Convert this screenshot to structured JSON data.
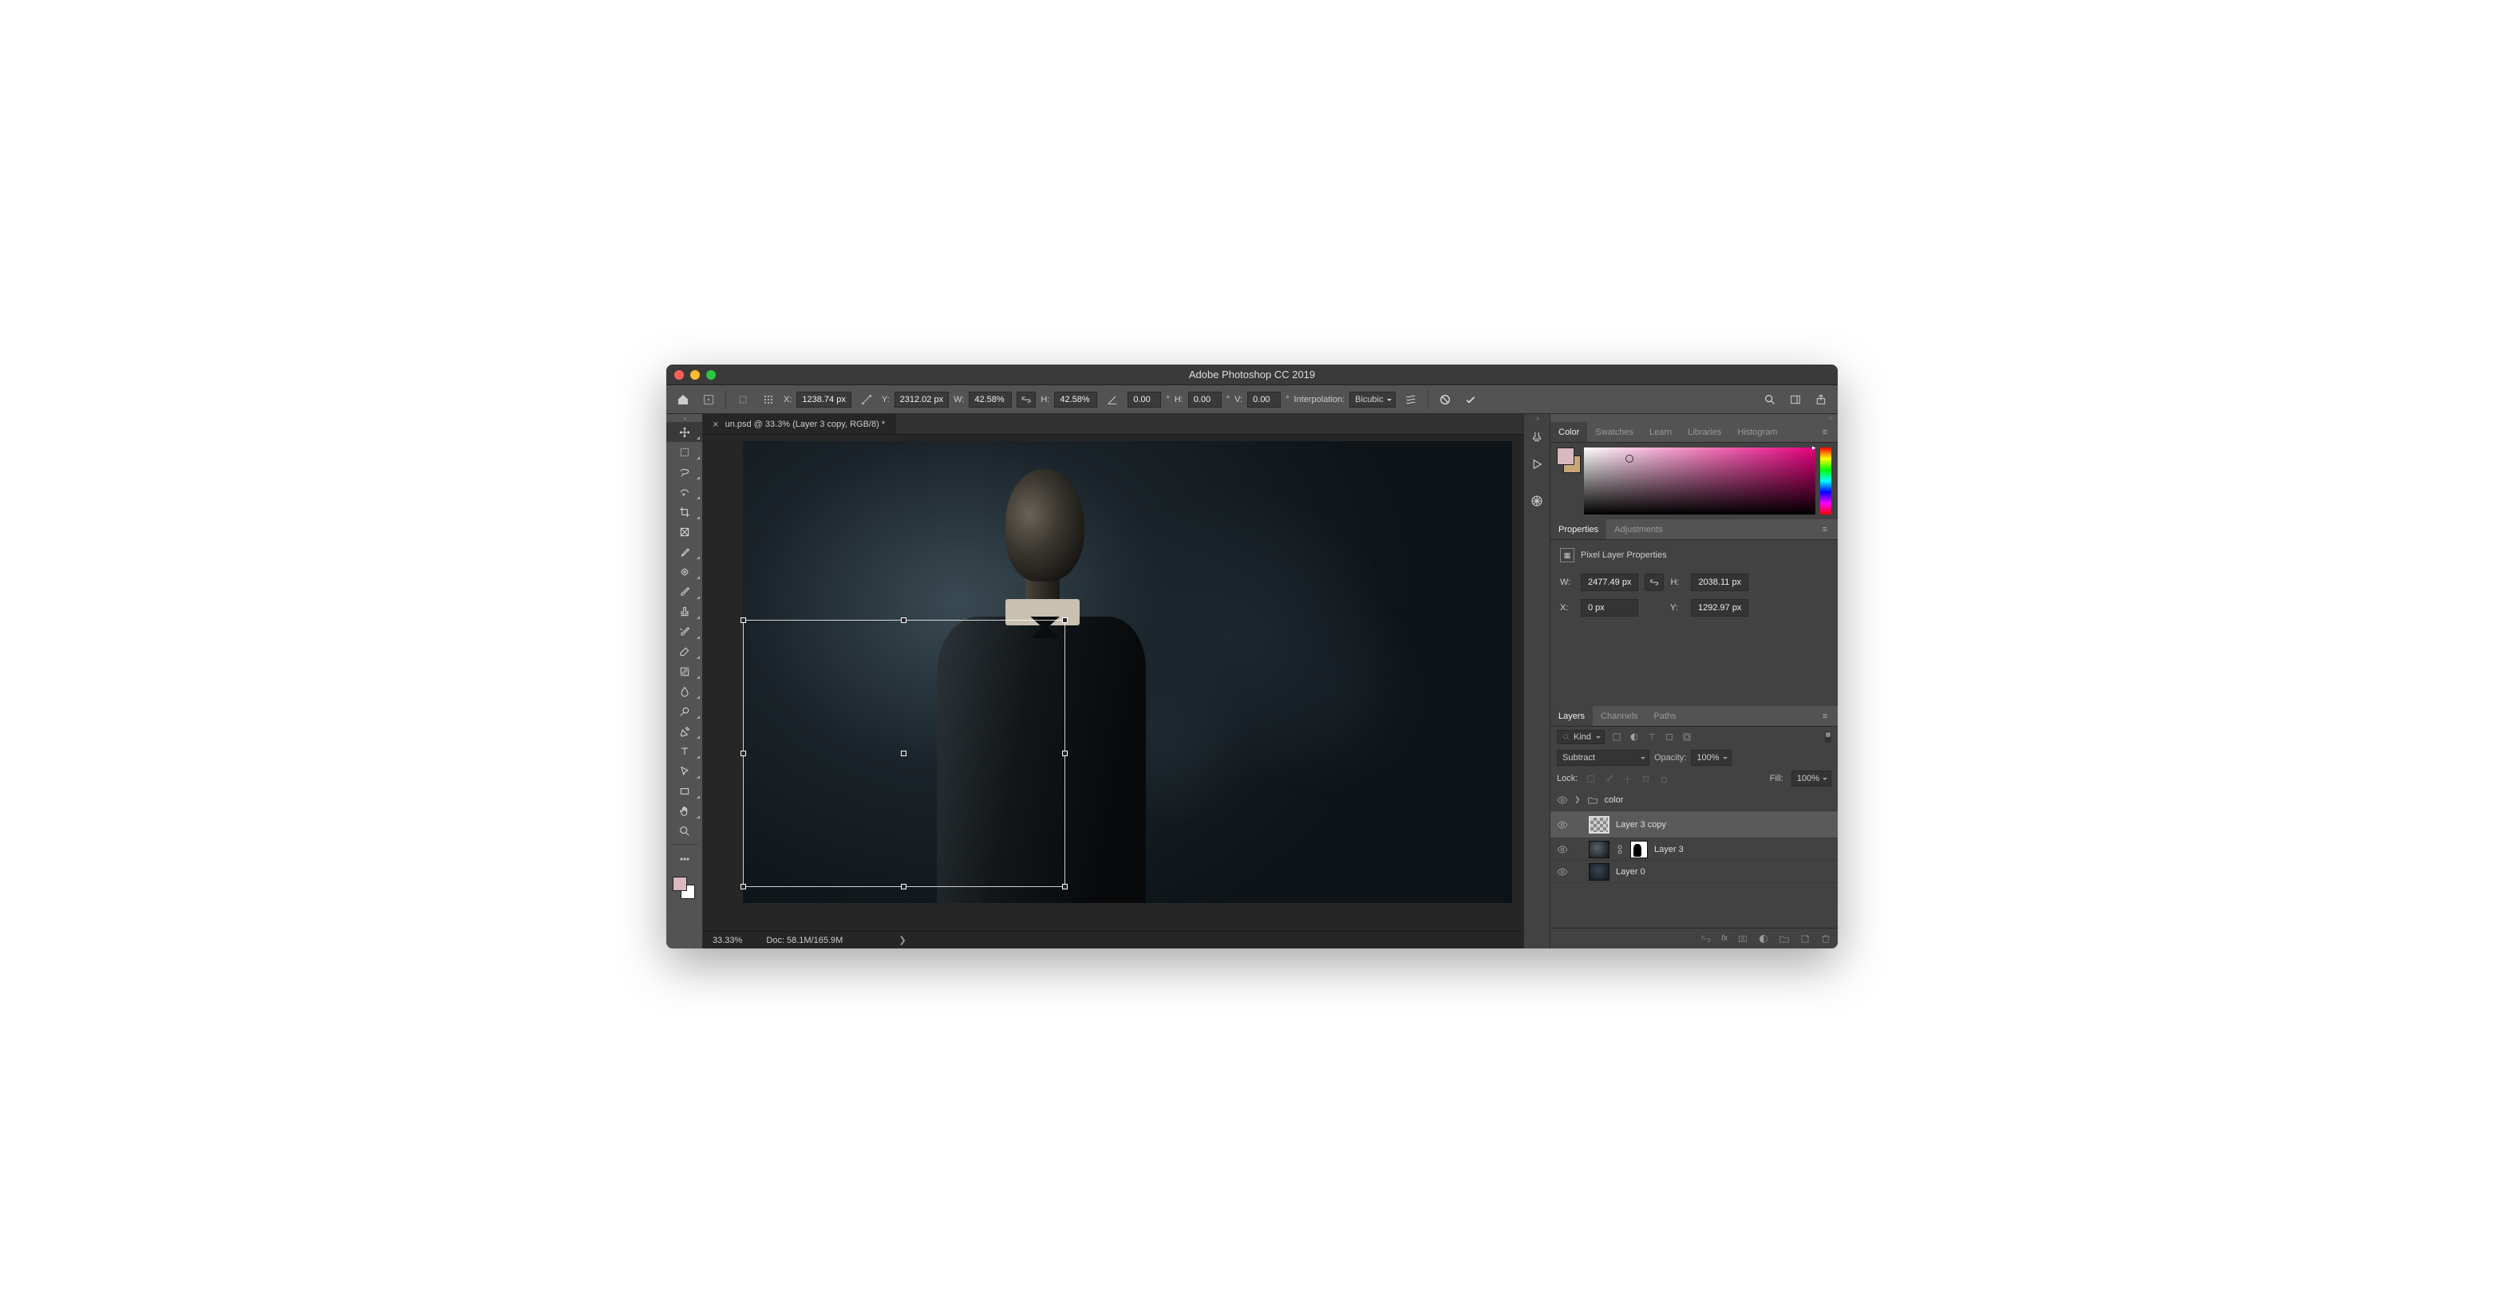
{
  "window": {
    "title": "Adobe Photoshop CC 2019"
  },
  "options": {
    "x_label": "X:",
    "x": "1238.74 px",
    "y_label": "Y:",
    "y": "2312.02 px",
    "w_label": "W:",
    "w": "42.58%",
    "h_label": "H:",
    "h": "42.58%",
    "angle": "0.00",
    "angle_unit": "°",
    "skew_h_label": "H:",
    "skew_h": "0.00",
    "skew_h_unit": "°",
    "skew_v_label": "V:",
    "skew_v": "0.00",
    "skew_v_unit": "°",
    "interp_label": "Interpolation:",
    "interp": "Bicubic"
  },
  "tab": {
    "title": "un.psd @ 33.3% (Layer 3 copy, RGB/8) *"
  },
  "status": {
    "zoom": "33.33%",
    "doc": "Doc: 58.1M/165.9M"
  },
  "panels": {
    "color_tabs": [
      "Color",
      "Swatches",
      "Learn",
      "Libraries",
      "Histogram"
    ],
    "props_tabs": [
      "Properties",
      "Adjustments"
    ],
    "layers_tabs": [
      "Layers",
      "Channels",
      "Paths"
    ]
  },
  "properties": {
    "title": "Pixel Layer Properties",
    "w_label": "W:",
    "w": "2477.49 px",
    "h_label": "H:",
    "h": "2038.11 px",
    "x_label": "X:",
    "x": "0 px",
    "y_label": "Y:",
    "y": "1292.97 px"
  },
  "layers": {
    "kind": "Kind",
    "blend": "Subtract",
    "opacity_label": "Opacity:",
    "opacity": "100%",
    "lock_label": "Lock:",
    "fill_label": "Fill:",
    "fill": "100%",
    "items": [
      {
        "name": "color"
      },
      {
        "name": "Layer 3 copy"
      },
      {
        "name": "Layer 3"
      },
      {
        "name": "Layer 0"
      }
    ]
  }
}
